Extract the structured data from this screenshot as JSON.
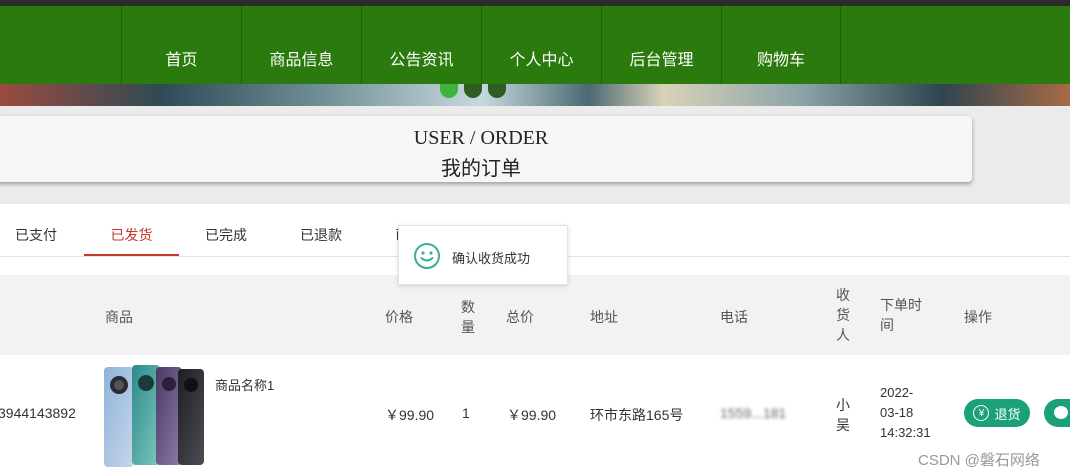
{
  "nav": {
    "items": [
      "首页",
      "商品信息",
      "公告资讯",
      "个人中心",
      "后台管理",
      "购物车"
    ]
  },
  "header": {
    "title_en": "USER / ORDER",
    "title_zh": "我的订单"
  },
  "tabs": [
    {
      "label": "已支付",
      "active": false
    },
    {
      "label": "已发货",
      "active": true
    },
    {
      "label": "已完成",
      "active": false
    },
    {
      "label": "已退款",
      "active": false
    },
    {
      "label": "已取消",
      "active": false
    }
  ],
  "toast": {
    "icon": "smile-icon",
    "message": "确认收货成功"
  },
  "table": {
    "headers": {
      "product": "商品",
      "price": "价格",
      "quantity": "数量",
      "total": "总价",
      "address": "地址",
      "phone": "电话",
      "receiver": "收货人",
      "order_time": "下单时间",
      "actions": "操作"
    },
    "rows": [
      {
        "order_no": "3944143892",
        "product_name": "商品名称1",
        "price": "￥99.90",
        "quantity": "1",
        "total": "￥99.90",
        "address": "环市东路165号",
        "phone": "1559...181",
        "receiver": "小吴",
        "order_time": "2022-03-18 14:32:31",
        "refund_label": "退货"
      }
    ]
  },
  "watermark": "CSDN @磐石网络",
  "colors": {
    "nav_bg": "#2a7a0e",
    "active_tab": "#c0392b",
    "button_teal": "#1aa17a"
  }
}
